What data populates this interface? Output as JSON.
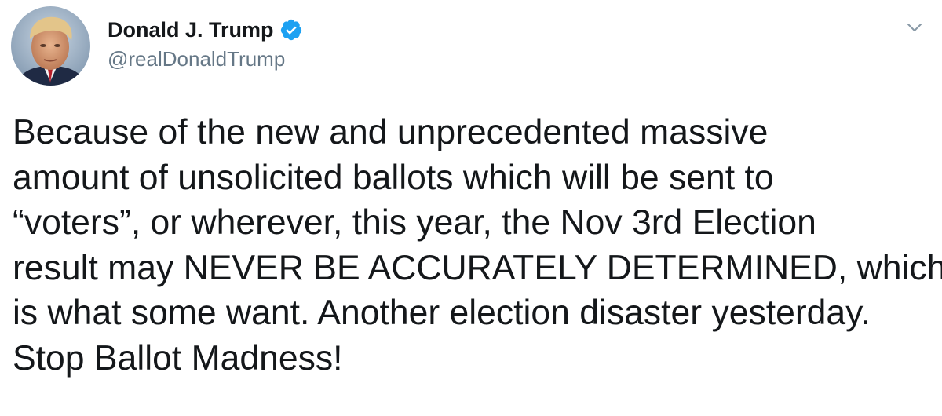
{
  "author": {
    "display_name": "Donald J. Trump",
    "handle": "@realDonaldTrump",
    "verified": true
  },
  "icons": {
    "verified": "verified-badge-icon",
    "caret": "chevron-down-icon"
  },
  "colors": {
    "verified_badge": "#1da1f2",
    "handle": "#657786",
    "text": "#14171a",
    "caret": "#8899a6"
  },
  "tweet": {
    "lines": [
      "Because of the new and unprecedented massive",
      "amount of unsolicited ballots which will be sent to",
      "“voters”, or wherever, this year, the Nov 3rd Election",
      "result may NEVER BE ACCURATELY DETERMINED, which",
      "is what some want. Another election disaster yesterday.",
      "Stop Ballot Madness!"
    ]
  }
}
